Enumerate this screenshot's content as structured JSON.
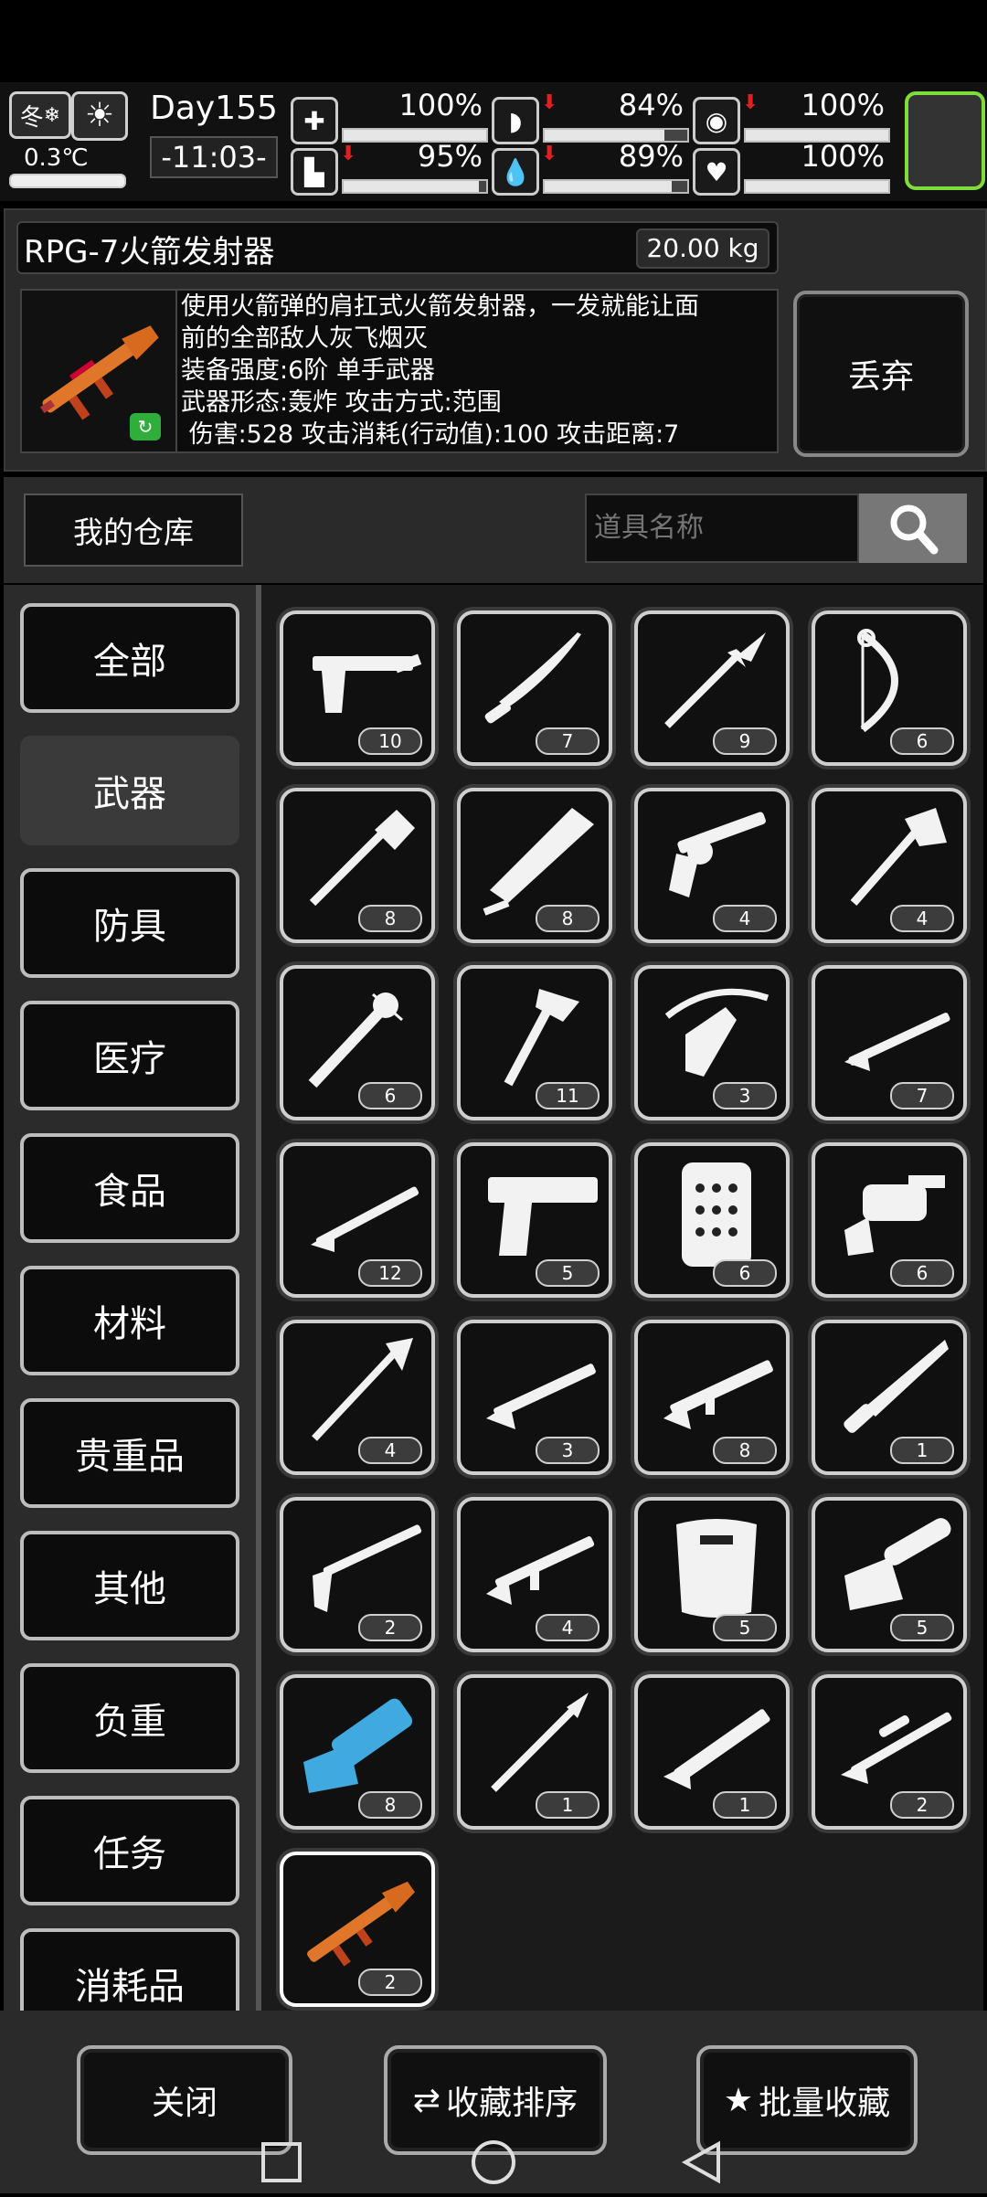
{
  "status": {
    "season": "冬",
    "temperature": "0.3℃",
    "day": "Day155",
    "time": "-11:03-",
    "stats": [
      {
        "icon": "medkit-icon",
        "percent": "100%",
        "value": 1.0
      },
      {
        "icon": "stomach-icon",
        "percent": "84%",
        "value": 0.84
      },
      {
        "icon": "mind-icon",
        "percent": "100%",
        "value": 1.0
      },
      {
        "icon": "boot-icon",
        "percent": "95%",
        "value": 0.95
      },
      {
        "icon": "water-drop-icon",
        "percent": "89%",
        "value": 0.89
      },
      {
        "icon": "heart-icon",
        "percent": "100%",
        "value": 1.0
      }
    ]
  },
  "detail": {
    "name": "RPG-7火箭发射器",
    "weight": "20.00 kg",
    "desc_lines": [
      "使用火箭弹的肩扛式火箭发射器，一发就能让面",
      "前的全部敌人灰飞烟灭",
      "装备强度:6阶 单手武器",
      "武器形态:轰炸 攻击方式:范围",
      " 伤害:528 攻击消耗(行动值):100 攻击距离:7"
    ],
    "discard_label": "丢弃"
  },
  "warehouse": {
    "title": "我的仓库",
    "search_placeholder": "道具名称"
  },
  "categories": [
    "全部",
    "武器",
    "防具",
    "医疗",
    "食品",
    "材料",
    "贵重品",
    "其他",
    "负重",
    "任务",
    "消耗品"
  ],
  "active_category": "武器",
  "items": [
    {
      "icon": "pistol-silenced-icon",
      "count": "10"
    },
    {
      "icon": "machete-icon",
      "count": "7"
    },
    {
      "icon": "spear-icon",
      "count": "9"
    },
    {
      "icon": "compound-bow-icon",
      "count": "6"
    },
    {
      "icon": "shovel-icon",
      "count": "8"
    },
    {
      "icon": "cleaver-icon",
      "count": "8"
    },
    {
      "icon": "revolver-icon",
      "count": "4"
    },
    {
      "icon": "hatchet-icon",
      "count": "4"
    },
    {
      "icon": "spiked-bat-icon",
      "count": "6"
    },
    {
      "icon": "fire-axe-icon",
      "count": "11"
    },
    {
      "icon": "crossbow-icon",
      "count": "3"
    },
    {
      "icon": "bolt-rifle-icon",
      "count": "7"
    },
    {
      "icon": "hunting-rifle-icon",
      "count": "12"
    },
    {
      "icon": "desert-eagle-icon",
      "count": "5"
    },
    {
      "icon": "riot-shield-icon",
      "count": "6"
    },
    {
      "icon": "grenade-launcher-icon",
      "count": "6"
    },
    {
      "icon": "halberd-icon",
      "count": "4"
    },
    {
      "icon": "carbine-icon",
      "count": "3"
    },
    {
      "icon": "assault-rifle-icon",
      "count": "8"
    },
    {
      "icon": "combat-knife-icon",
      "count": "1"
    },
    {
      "icon": "shotgun-icon",
      "count": "2"
    },
    {
      "icon": "m4-rifle-icon",
      "count": "4"
    },
    {
      "icon": "police-shield-icon",
      "count": "5"
    },
    {
      "icon": "chainsaw-icon",
      "count": "5"
    },
    {
      "icon": "minigun-icon",
      "count": "8"
    },
    {
      "icon": "scalpel-icon",
      "count": "1"
    },
    {
      "icon": "tactical-rifle-icon",
      "count": "1"
    },
    {
      "icon": "sniper-rifle-icon",
      "count": "2"
    },
    {
      "icon": "rpg-launcher-icon",
      "count": "2"
    }
  ],
  "buttons": {
    "close": "关闭",
    "sort": "收藏排序",
    "batch": "批量收藏"
  },
  "colors": {
    "accent_green": "#7fdc3a",
    "rpg_orange": "#e0762a",
    "minigun_blue": "#3fa9e0"
  }
}
